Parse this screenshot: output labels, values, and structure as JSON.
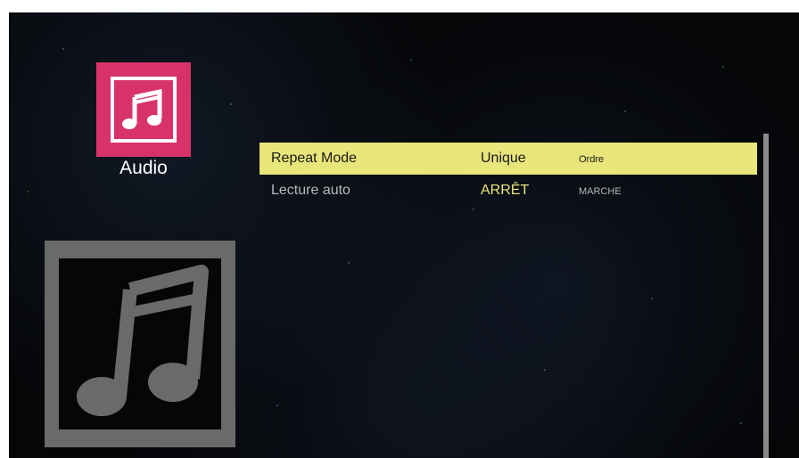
{
  "category": {
    "label": "Audio",
    "icon": "music-note-icon",
    "accent_color": "#d8326a"
  },
  "preview": {
    "icon": "music-note-icon"
  },
  "settings": [
    {
      "label": "Repeat Mode",
      "value": "Unique",
      "alternate": "Ordre",
      "selected": true
    },
    {
      "label": "Lecture auto",
      "value": "ARRÊT",
      "alternate": "MARCHE",
      "selected": false
    }
  ],
  "colors": {
    "highlight": "#e8e57a",
    "background": "#050608"
  }
}
